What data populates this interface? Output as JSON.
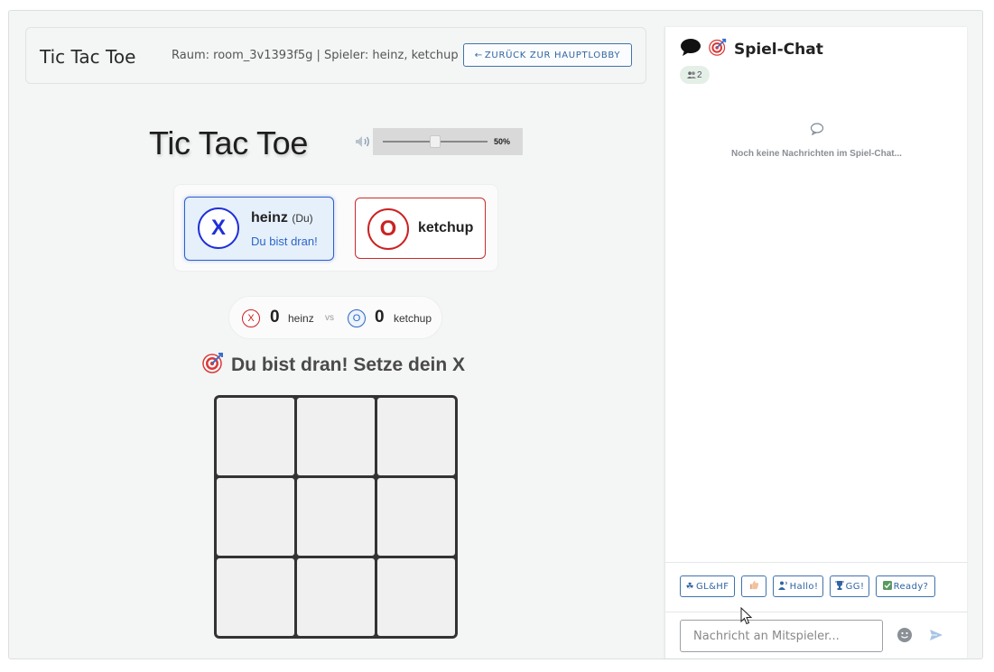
{
  "header": {
    "brand": "Tic Tac Toe",
    "room_info": "Raum: room_3v1393f5g | Spieler: heinz, ketchup",
    "back_button": "ZURÜCK ZUR HAUPTLOBBY"
  },
  "game": {
    "title": "Tic Tac Toe",
    "volume_percent": "50%",
    "volume_level": 0.5,
    "player_x": {
      "mark": "X",
      "name": "heinz",
      "you_tag": "(Du)",
      "turn_text": "Du bist dran!"
    },
    "player_o": {
      "mark": "O",
      "name": "ketchup"
    },
    "score": {
      "x_mark": "X",
      "x_score": "0",
      "x_name": "heinz",
      "vs": "vs",
      "o_mark": "O",
      "o_score": "0",
      "o_name": "ketchup"
    },
    "status": "Du bist dran! Setze dein X",
    "board": [
      "",
      "",
      "",
      "",
      "",
      "",
      "",
      "",
      ""
    ]
  },
  "chat": {
    "title": "Spiel-Chat",
    "online_count": "2",
    "empty_text": "Noch keine Nachrichten im Spiel-Chat...",
    "quick_replies": {
      "glhf": "GL&HF",
      "hallo": "Hallo!",
      "gg": "GG!",
      "ready": "Ready?"
    },
    "input_placeholder": "Nachricht an Mitspieler..."
  },
  "colors": {
    "accent_blue": "#3065a3",
    "player_x": "#1f2fd8",
    "player_o": "#cc2222"
  }
}
